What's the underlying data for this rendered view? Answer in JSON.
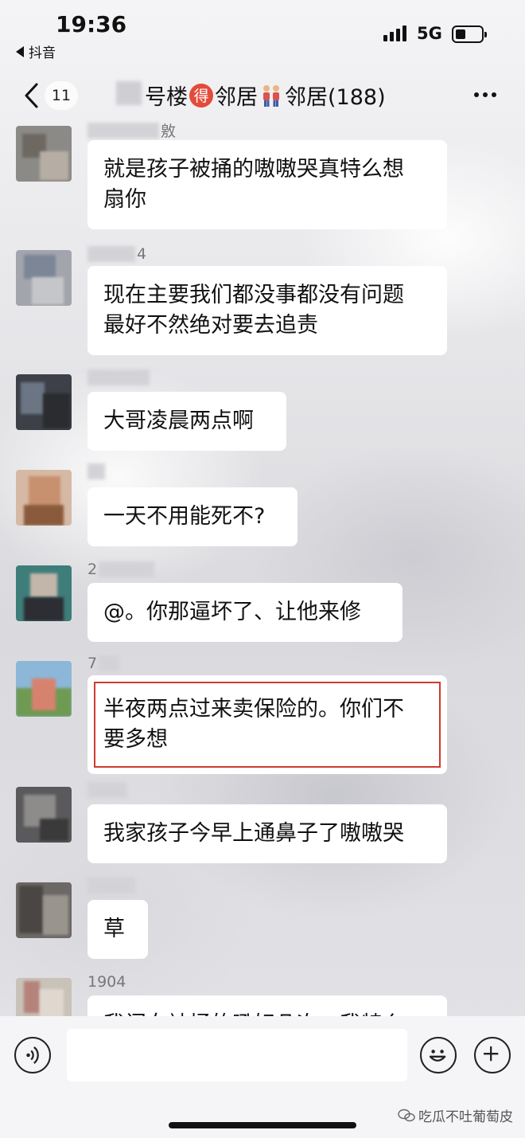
{
  "status_bar": {
    "time": "19:36",
    "back_app": "抖音",
    "network": "5G"
  },
  "header": {
    "unread_count": "11",
    "title_part1": "号楼",
    "title_badge": "得",
    "title_part2": "邻居",
    "title_part3": "邻居(188)"
  },
  "messages": [
    {
      "name": "敫",
      "lines": [
        "就是孩子被捅的嗷嗷哭真特么想",
        "扇你"
      ]
    },
    {
      "name": "4",
      "lines": [
        "现在主要我们都没事都没有问题",
        "最好不然绝对要去追责"
      ]
    },
    {
      "name": "",
      "lines": [
        "大哥凌晨两点啊"
      ]
    },
    {
      "name": "",
      "lines": [
        "一天不用能死不?"
      ]
    },
    {
      "name": "2",
      "lines": [
        "@。你那逼坏了、让他来修"
      ]
    },
    {
      "name": "7",
      "lines": [
        "半夜两点过来卖保险的。你们不",
        "要多想"
      ],
      "highlighted": true
    },
    {
      "name": "",
      "lines": [
        "我家孩子今早上通鼻子了嗷嗷哭"
      ]
    },
    {
      "name": "",
      "lines": [
        "草"
      ]
    },
    {
      "name": "1904",
      "lines": [
        "我闺女被捅的吼好几次，我特么"
      ]
    }
  ],
  "bottom": {
    "watermark": "吃瓜不吐葡萄皮"
  }
}
